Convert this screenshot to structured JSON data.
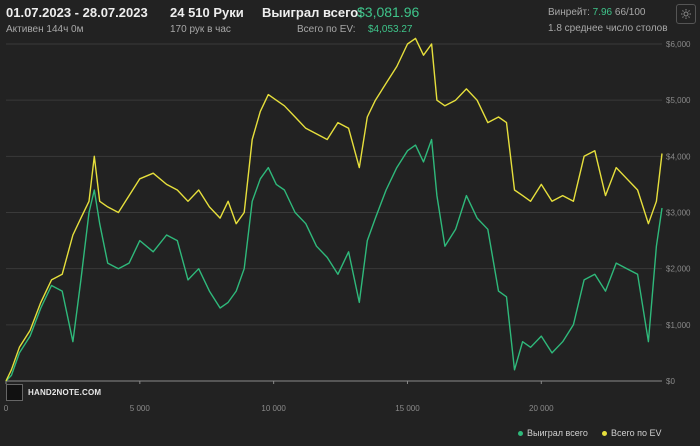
{
  "header": {
    "date_range": "01.07.2023 - 28.07.2023",
    "active": "Активен 144ч 0м",
    "hands": "24 510 Руки",
    "hands_per_hour": "170 рук в час",
    "won_label": "Выиграл всего:",
    "won_value": "$3,081.96",
    "ev_label": "Всего по EV:",
    "ev_value": "$4,053.27",
    "winrate_label": "Винрейт:",
    "winrate_value": "7.96",
    "winrate_rest": "66/100",
    "tables_text": "1.8 среднее число столов",
    "settings_icon": "gear-icon"
  },
  "logo": {
    "text": "HAND2NOTE.COM"
  },
  "colors": {
    "won": "#2fb97b",
    "ev": "#e6df3c",
    "background": "#222222",
    "grid": "#3a3a3a"
  },
  "chart_data": {
    "type": "line",
    "xlabel": "",
    "ylabel": "",
    "xlim": [
      0,
      24510
    ],
    "ylim": [
      0,
      6000
    ],
    "x_ticks": [
      0,
      5000,
      10000,
      15000,
      20000
    ],
    "x_tick_labels": [
      "0",
      "5 000",
      "10 000",
      "15 000",
      "20 000"
    ],
    "y_ticks": [
      0,
      1000,
      2000,
      3000,
      4000,
      5000,
      6000
    ],
    "y_tick_labels": [
      "$0",
      "$1,000",
      "$2,000",
      "$3,000",
      "$4,000",
      "$5,000",
      "$6,000"
    ],
    "y_axis_position": "right",
    "grid": true,
    "legend_position": "bottom-right",
    "series": [
      {
        "name": "Выиграл всего",
        "color": "#2fb97b",
        "x": [
          0,
          200,
          500,
          900,
          1300,
          1700,
          2100,
          2500,
          2800,
          3100,
          3300,
          3500,
          3800,
          4200,
          4600,
          5000,
          5500,
          6000,
          6400,
          6800,
          7200,
          7600,
          8000,
          8300,
          8600,
          8900,
          9200,
          9500,
          9800,
          10100,
          10400,
          10800,
          11200,
          11600,
          12000,
          12400,
          12800,
          13200,
          13500,
          13800,
          14200,
          14600,
          15000,
          15300,
          15600,
          15900,
          16100,
          16400,
          16800,
          17200,
          17600,
          18000,
          18400,
          18700,
          19000,
          19300,
          19600,
          20000,
          20400,
          20800,
          21200,
          21600,
          22000,
          22400,
          22800,
          23200,
          23600,
          24000,
          24300,
          24510
        ],
        "values": [
          0,
          100,
          500,
          800,
          1300,
          1700,
          1600,
          700,
          1800,
          3000,
          3400,
          2800,
          2100,
          2000,
          2100,
          2500,
          2300,
          2600,
          2500,
          1800,
          2000,
          1600,
          1300,
          1400,
          1600,
          2000,
          3200,
          3600,
          3800,
          3500,
          3400,
          3000,
          2800,
          2400,
          2200,
          1900,
          2300,
          1400,
          2500,
          2900,
          3400,
          3800,
          4100,
          4200,
          3900,
          4300,
          3300,
          2400,
          2700,
          3300,
          2900,
          2700,
          1600,
          1500,
          200,
          700,
          600,
          800,
          500,
          700,
          1000,
          1800,
          1900,
          1600,
          2100,
          2000,
          1900,
          700,
          2400,
          3080
        ]
      },
      {
        "name": "Всего по EV",
        "color": "#e6df3c",
        "x": [
          0,
          200,
          500,
          900,
          1300,
          1700,
          2100,
          2500,
          2800,
          3100,
          3300,
          3500,
          3800,
          4200,
          4600,
          5000,
          5500,
          6000,
          6400,
          6800,
          7200,
          7600,
          8000,
          8300,
          8600,
          8900,
          9200,
          9500,
          9800,
          10100,
          10400,
          10800,
          11200,
          11600,
          12000,
          12400,
          12800,
          13200,
          13500,
          13800,
          14200,
          14600,
          15000,
          15300,
          15600,
          15900,
          16100,
          16400,
          16800,
          17200,
          17600,
          18000,
          18400,
          18700,
          19000,
          19300,
          19600,
          20000,
          20400,
          20800,
          21200,
          21600,
          22000,
          22400,
          22800,
          23200,
          23600,
          24000,
          24300,
          24510
        ],
        "values": [
          0,
          200,
          600,
          900,
          1400,
          1800,
          1900,
          2600,
          2900,
          3200,
          4000,
          3200,
          3100,
          3000,
          3300,
          3600,
          3700,
          3500,
          3400,
          3200,
          3400,
          3100,
          2900,
          3200,
          2800,
          3000,
          4300,
          4800,
          5100,
          5000,
          4900,
          4700,
          4500,
          4400,
          4300,
          4600,
          4500,
          3800,
          4700,
          5000,
          5300,
          5600,
          6000,
          6100,
          5800,
          6000,
          5000,
          4900,
          5000,
          5200,
          5000,
          4600,
          4700,
          4600,
          3400,
          3300,
          3200,
          3500,
          3200,
          3300,
          3200,
          4000,
          4100,
          3300,
          3800,
          3600,
          3400,
          2800,
          3200,
          4050
        ]
      }
    ]
  },
  "legend": [
    {
      "label": "Выиграл всего",
      "color": "#2fb97b"
    },
    {
      "label": "Всего по EV",
      "color": "#e6df3c"
    }
  ]
}
